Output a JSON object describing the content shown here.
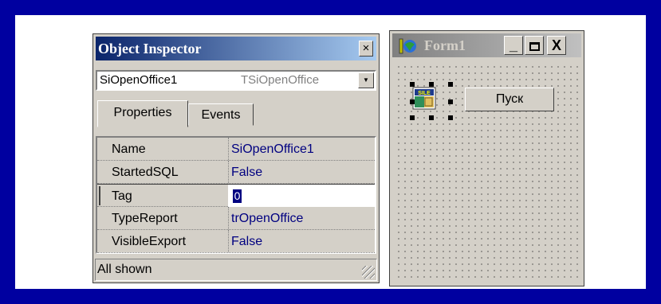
{
  "object_inspector": {
    "title": "Object Inspector",
    "close_glyph": "×",
    "component": {
      "name": "SiOpenOffice1",
      "type": "TSiOpenOffice"
    },
    "tabs": [
      {
        "label": "Properties",
        "active": true
      },
      {
        "label": "Events",
        "active": false
      }
    ],
    "properties": [
      {
        "name": "Name",
        "value": "SiOpenOffice1"
      },
      {
        "name": "StartedSQL",
        "value": "False"
      },
      {
        "name": "Tag",
        "value": "0"
      },
      {
        "name": "TypeReport",
        "value": "trOpenOffice"
      },
      {
        "name": "VisibleExport",
        "value": "False"
      }
    ],
    "status": "All shown"
  },
  "form": {
    "title": "Form1",
    "minimize": "_",
    "close": "X",
    "button_label": "Пуск"
  },
  "colors": {
    "background": "#0000a0",
    "title_active": "#0a246a",
    "value_text": "#000080"
  }
}
